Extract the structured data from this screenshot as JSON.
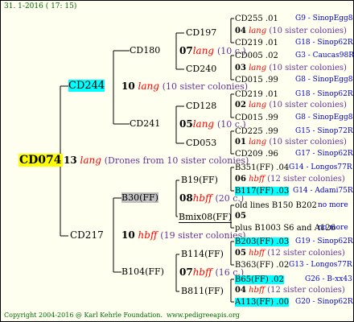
{
  "header": "31.  1-2016 ( 17: 15)",
  "footer": {
    "copyright": "Copyright 2004-2016 @ Karl Kehrle Foundation.",
    "site": "www.pedigreeapis.org"
  },
  "colors": {
    "background": "#fffff0",
    "highlight_cyan": "#00ffff",
    "highlight_yellow": "#ffff00",
    "highlight_grey": "#c0c0c0",
    "lang": "#ff0000",
    "desc": "#663399",
    "link": "#0000cc",
    "green": "#006600"
  },
  "root": {
    "id": "CD074",
    "num": "13",
    "lang": "lang",
    "desc": "(Drones from 10 sister colonies)"
  },
  "gen1": [
    {
      "id": "CD244",
      "num": "10",
      "lang": "lang",
      "desc": "(10 sister colonies)"
    },
    {
      "id": "CD217",
      "num": "10",
      "lang": "hbff",
      "desc": "(19 sister colonies)"
    }
  ],
  "gen2": [
    {
      "id": "CD180",
      "num": "07",
      "lang": "lang",
      "desc": "(10 c.)"
    },
    {
      "id": "CD241",
      "num": "05",
      "lang": "lang",
      "desc": "(10 c.)"
    },
    {
      "id": "B30(FF)",
      "num": "08",
      "lang": "hbff",
      "desc": "(20 c.)"
    },
    {
      "id": "B104(FF)",
      "num": "07",
      "lang": "hbff",
      "desc": "(16 c.)"
    }
  ],
  "gen3": [
    {
      "id": "CD197",
      "num": "04",
      "lang": "lang",
      "desc": "(10 sister colonies)"
    },
    {
      "id": "CD240",
      "num": "03",
      "lang": "lang",
      "desc": "(10 sister colonies)"
    },
    {
      "id": "CD128",
      "num": "02",
      "lang": "lang",
      "desc": "(10 sister colonies)"
    },
    {
      "id": "CD053",
      "num": "01",
      "lang": "lang",
      "desc": "(10 sister colonies)"
    },
    {
      "id": "B19(FF)",
      "num": "06",
      "lang": "hbff",
      "desc": "(12 sister colonies)"
    },
    {
      "id": "Bmix08(FF)",
      "num": "05",
      "lang": "",
      "desc": ""
    },
    {
      "id": "B114(FF)",
      "num": "05",
      "lang": "hbff",
      "desc": "(12 sister colonies)"
    },
    {
      "id": "B811(FF)",
      "num": "04",
      "lang": "hbff",
      "desc": "(12 sister colonies)"
    }
  ],
  "gen4": [
    {
      "id": "CD255 .01",
      "info": "G9 - SinopEgg86R"
    },
    {
      "id": "CD219 .01",
      "info": "G18 - Sinop62R"
    },
    {
      "id": "CD005 .02",
      "info": "G3 - Caucas98R"
    },
    {
      "id": "CD015 .99",
      "info": "G8 - SinopEgg86R"
    },
    {
      "id": "CD219 .01",
      "info": "G18 - Sinop62R"
    },
    {
      "id": "CD015 .99",
      "info": "G8 - SinopEgg86R"
    },
    {
      "id": "CD225 .99",
      "info": "G15 - Sinop72R"
    },
    {
      "id": "CD209 .96",
      "info": "G17 - Sinop62R"
    },
    {
      "id": "B351(FF) .04",
      "info": "G14 - Longos77R"
    },
    {
      "id": "B117(FF) .03",
      "info": "G14 - Adami75R"
    },
    {
      "id": "old lines B150 B202",
      "info": "no more"
    },
    {
      "id": "plus B1003 S6 and A126",
      "info": "no more"
    },
    {
      "id": "B203(FF) .03",
      "info": "G19 - Sinop62R"
    },
    {
      "id": "B363(FF) .02",
      "info": "G13 - Longos77R"
    },
    {
      "id": "B65(FF) .02",
      "info": "G26 - B-xx43"
    },
    {
      "id": "A113(FF) .00",
      "info": "G20 - Sinop62R"
    }
  ]
}
